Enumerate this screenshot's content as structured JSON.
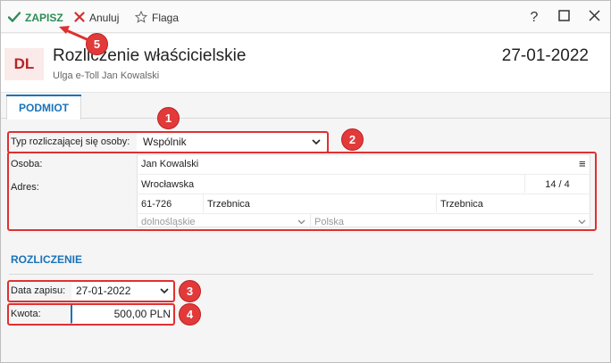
{
  "toolbar": {
    "save_label": "ZAPISZ",
    "cancel_label": "Anuluj",
    "flag_label": "Flaga",
    "help_label": "?",
    "maximize_label": "☐",
    "close_label": "✕"
  },
  "header": {
    "avatar_text": "DL",
    "title": "Rozliczenie właścicielskie",
    "subtitle": "Ulga e-Toll Jan Kowalski",
    "date": "27-01-2022"
  },
  "tabs": [
    {
      "label": "PODMIOT"
    }
  ],
  "podmiot": {
    "type_label": "Typ rozliczającej się osoby:",
    "type_value": "Wspólnik",
    "person_label": "Osoba:",
    "person_value": "Jan Kowalski",
    "address_label": "Adres:",
    "street": "Wrocławska",
    "house_number": "14 / 4",
    "postal_code": "61-726",
    "city": "Trzebnica",
    "post_office": "Trzebnica",
    "voivodeship": "dolnośląskie",
    "country": "Polska"
  },
  "rozliczenie": {
    "section_title": "ROZLICZENIE",
    "date_label": "Data zapisu:",
    "date_value": "27-01-2022",
    "amount_label": "Kwota:",
    "amount_value": "500,00 PLN"
  },
  "markers": [
    "1",
    "2",
    "3",
    "4",
    "5"
  ],
  "colors": {
    "accent": "#1a73b8",
    "save_green": "#2e8b57",
    "cancel_red": "#d32f2f",
    "marker_red": "#e23a3a",
    "avatar_bg": "#fbeaea",
    "avatar_fg": "#b42626"
  },
  "icons": {
    "save": "check-icon",
    "cancel": "x-icon",
    "flag": "star-icon",
    "person_menu": "hamburger-icon",
    "dropdown": "chevron-down-icon"
  }
}
